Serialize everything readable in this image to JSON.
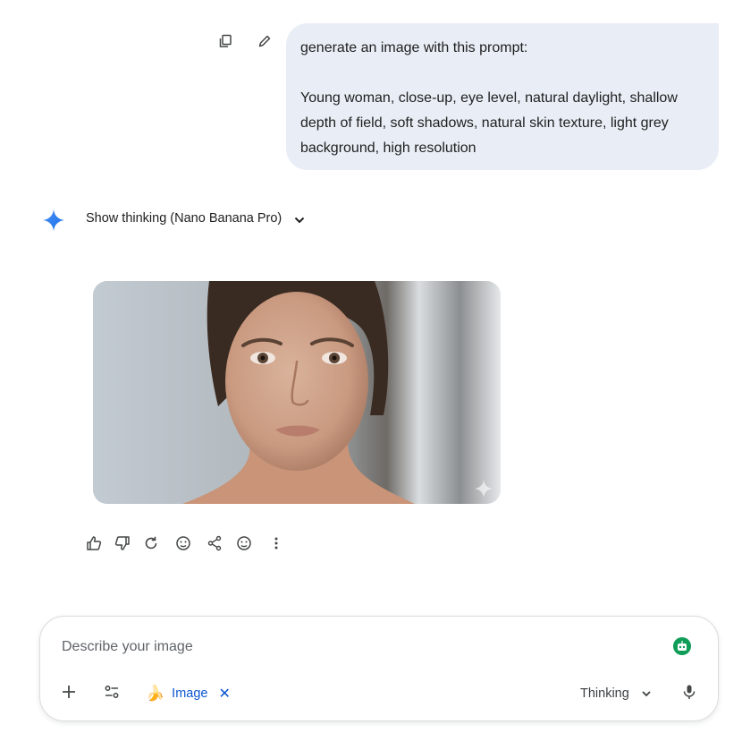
{
  "message": {
    "line1": "generate an image with this prompt:",
    "line2": "Young woman, close-up, eye level, natural daylight, shallow depth of field, soft shadows, natural skin texture, light grey background, high resolution"
  },
  "thinking": {
    "label": "Show thinking (Nano Banana Pro)"
  },
  "composer": {
    "placeholder": "Describe your image",
    "chip_label": "Image",
    "chip_remove": "✕",
    "chip_emoji": "🍌",
    "mode_label": "Thinking"
  },
  "colors": {
    "bubble": "#e9eef6",
    "accent_blue": "#0b57d0",
    "gemini_star": "#4285f4",
    "badge_green": "#0f9d58"
  }
}
